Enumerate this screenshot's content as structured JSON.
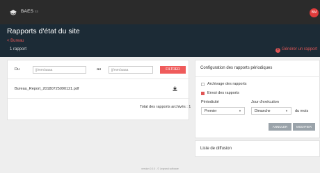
{
  "app": {
    "name": "BAES",
    "subtitle": "ss",
    "avatar_initials": "BM"
  },
  "header": {
    "title": "Rapports d'état du site",
    "back_link": "< Bureau",
    "report_count": "1 rapport",
    "generate_label": "Générer un rapport"
  },
  "filter": {
    "from_label": "Du",
    "from_placeholder": "jj/mm/aaaa",
    "to_label": "au",
    "to_placeholder": "jj/mm/aaaa",
    "button_label": "FILTRER"
  },
  "reports": [
    {
      "file_name": "Bureau_Report_20180725090121.pdf"
    }
  ],
  "total_label": "Total des rapports archivés : 1",
  "periodic_config": {
    "title": "Configuration des rapports périodiques",
    "archive_label": "Archivage des rapports",
    "archive_checked": false,
    "send_label": "Envoi des rapports",
    "send_checked": true,
    "periodicity_label": "Périodicité",
    "periodicity_value": "Premier",
    "day_label": "Jour d'exécution",
    "day_value": "Dimanche",
    "month_suffix": "du mois",
    "cancel_label": "ANNULER",
    "modify_label": "MODIFIER"
  },
  "distribution": {
    "title": "Liste de diffusion"
  },
  "footer": {
    "text": "version 0.0.0 - © Legrand software"
  },
  "colors": {
    "accent": "#e05555",
    "header_bg": "#1c2b36",
    "topbar_bg": "#2b2b2b"
  }
}
